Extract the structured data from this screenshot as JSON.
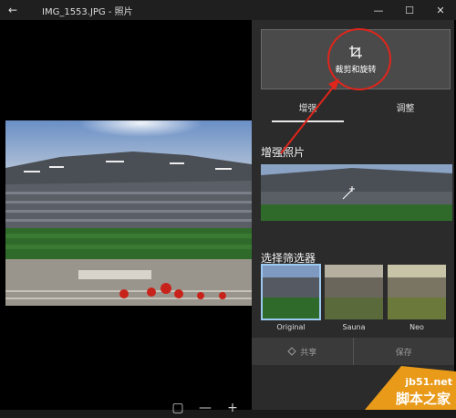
{
  "window": {
    "title": "IMG_1553.JPG - 照片",
    "back_icon": "back-arrow-icon",
    "minimize_icon": "minimize-icon",
    "maximize_icon": "maximize-icon",
    "close_icon": "close-icon"
  },
  "viewer": {
    "zoom_controls": [
      "fit-to-screen-icon",
      "zoom-out-icon",
      "zoom-in-icon"
    ]
  },
  "panel": {
    "crop_rotate_label": "裁剪和旋转",
    "tabs": [
      {
        "label": "增强",
        "active": true
      },
      {
        "label": "调整",
        "active": false
      }
    ],
    "enhance_title": "增强照片",
    "filters_title": "选择筛选器",
    "filters": [
      {
        "label": "Original",
        "selected": true
      },
      {
        "label": "Sauna",
        "selected": false
      },
      {
        "label": "Neo",
        "selected": false
      }
    ],
    "share_label": "共享",
    "save_label": "保存"
  },
  "watermark": {
    "url": "jb51.net",
    "text": "脚本之家"
  },
  "colors": {
    "highlight": "#e0251b",
    "panel_bg": "#2b2b2b",
    "titlebar_bg": "#1f1f1f"
  }
}
